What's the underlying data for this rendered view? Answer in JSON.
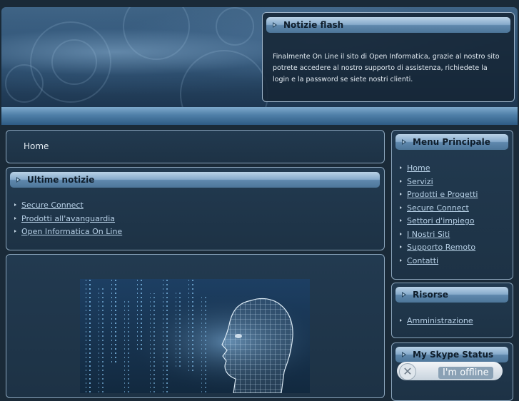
{
  "flash": {
    "title": "Notizie flash",
    "text": "Finalmente On Line il sito di Open Informatica, grazie al nostro sito potrete accedere al nostro supporto di assistenza, richiedete la login e la password se siete nostri clienti."
  },
  "breadcrumb": {
    "home": "Home"
  },
  "news": {
    "title": "Ultime notizie",
    "items": [
      "Secure Connect",
      "Prodotti all'avanguardia",
      "Open Informatica On Line"
    ]
  },
  "menu": {
    "title": "Menu Principale",
    "items": [
      "Home",
      "Servizi",
      "Prodotti e Progetti",
      "Secure Connect",
      "Settori d'impiego",
      "I Nostri Siti",
      "Supporto Remoto",
      "Contatti"
    ]
  },
  "resources": {
    "title": "Risorse",
    "items": [
      "Amministrazione"
    ]
  },
  "skype": {
    "title": "My Skype Status",
    "status": "I'm offline",
    "icon": "skype-offline-icon"
  },
  "colors": {
    "background": "#1a2a38",
    "bar": "#86aacb",
    "link": "#b7d0e6",
    "border": "#8aa4bb"
  }
}
